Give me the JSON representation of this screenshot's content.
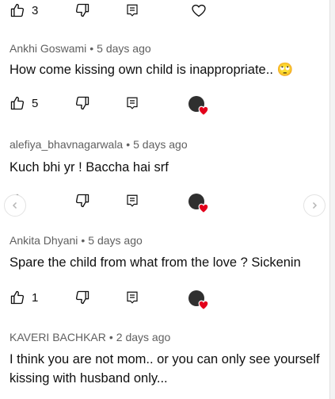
{
  "comments": [
    {
      "likes": "3"
    },
    {
      "author": "Ankhi Goswami",
      "time": "5 days ago",
      "text": "How come kissing own child is inappropriate.. 🙄",
      "likes": "5"
    },
    {
      "author": "alefiya_bhavnagarwala",
      "time": "5 days ago",
      "text": "Kuch bhi yr ! Baccha hai srf"
    },
    {
      "author": "Ankita Dhyani",
      "time": "5 days ago",
      "text": "Spare the child from what from the love ? Sickenin",
      "likes": "1"
    },
    {
      "author": "KAVERI BACHKAR",
      "time": "2 days ago",
      "text": "I think you are not mom.. or you can only see yourself kissing with husband only..."
    }
  ],
  "separator": "•",
  "colors": {
    "text": "#0f0f0f",
    "meta": "#606060",
    "icon": "#0f0f0f",
    "heart": "#e3001b"
  },
  "icons": [
    "thumbs-up-icon",
    "thumbs-down-icon",
    "reply-icon",
    "heart-icon",
    "creator-avatar",
    "chevron-left-icon",
    "chevron-right-icon"
  ]
}
